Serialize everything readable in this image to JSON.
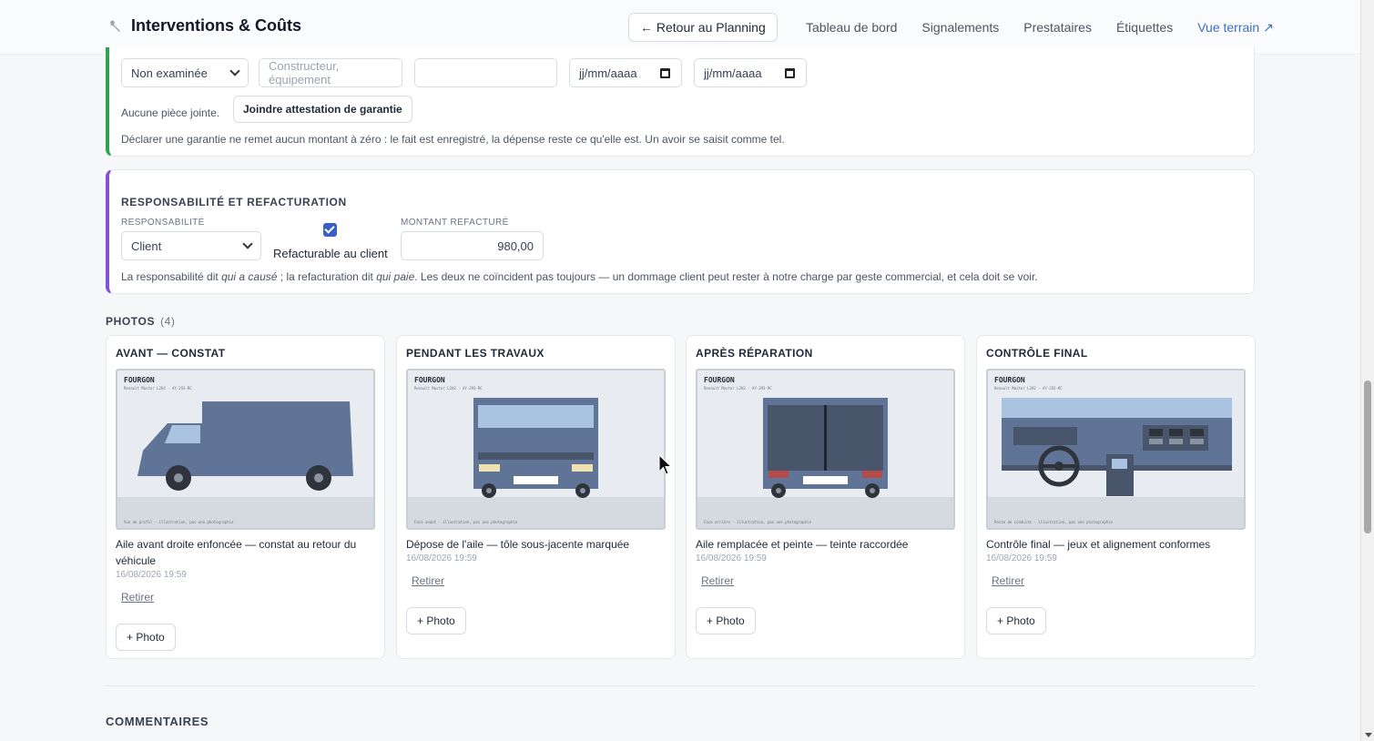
{
  "header": {
    "title": "Interventions & Coûts",
    "back_label": "← Retour au Planning",
    "nav": [
      "Tableau de bord",
      "Signalements",
      "Prestataires",
      "Étiquettes",
      "Vue terrain ↗"
    ]
  },
  "warranty": {
    "status_value": "Non examinée",
    "maker_placeholder": "Constructeur, équipement",
    "ref_value": "",
    "date_from_placeholder": "jj/mm/aaaa",
    "date_to_placeholder": "jj/mm/aaaa",
    "no_attachment": "Aucune pièce jointe.",
    "attach_label": "Joindre attestation de garantie",
    "note": "Déclarer une garantie ne remet aucun montant à zéro : le fait est enregistré, la dépense reste ce qu'elle est. Un avoir se saisit comme tel."
  },
  "responsibility": {
    "section_title": "Responsabilité et refacturation",
    "resp_label": "Responsabilité",
    "resp_value": "Client",
    "rebill_checked": true,
    "rebill_label": "Refacturable au client",
    "amount_label": "Montant refacturé",
    "amount_value": "980,00",
    "note_a": "La responsabilité dit ",
    "note_b": "qui a causé",
    "note_c": " ; la refacturation dit ",
    "note_d": "qui paie",
    "note_e": ". Les deux ne coïncident pas toujours — un dommage client peut rester à notre charge par geste commercial, et cela doit se voir."
  },
  "photos": {
    "title": "PHOTOS",
    "count": "(4)",
    "remove_label": "Retirer",
    "add_label": "+ Photo",
    "img_tag": "FOURGON",
    "img_sub": "Renault Master L2H2 · AY-293-RC",
    "items": [
      {
        "stage": "Avant — constat",
        "caption": "Aile avant droite enfoncée — constat au retour du véhicule",
        "date": "16/08/2026 19:59",
        "foot": "Vue de profil · illustration, pas une photographie"
      },
      {
        "stage": "Pendant les travaux",
        "caption": "Dépose de l'aile — tôle sous-jacente marquée",
        "date": "16/08/2026 19:59",
        "foot": "Face avant · illustration, pas une photographie"
      },
      {
        "stage": "Après réparation",
        "caption": "Aile remplacée et peinte — teinte raccordée",
        "date": "16/08/2026 19:59",
        "foot": "Face arrière · illustration, pas une photographie"
      },
      {
        "stage": "Contrôle final",
        "caption": "Contrôle final — jeux et alignement conformes",
        "date": "16/08/2026 19:59",
        "foot": "Poste de conduite · illustration, pas une photographie"
      }
    ]
  },
  "comments": {
    "title": "COMMENTAIRES"
  },
  "colors": {
    "van": "#5f7496",
    "window": "#a9c3e0",
    "wheel": "#2f343c",
    "accent": "#3a6fc9"
  }
}
